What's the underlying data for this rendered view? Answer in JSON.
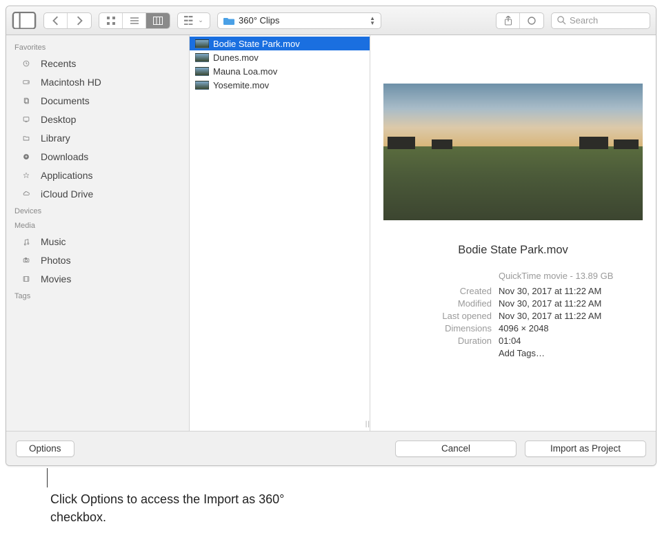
{
  "toolbar": {
    "path_label": "360° Clips",
    "search_placeholder": "Search"
  },
  "sidebar": {
    "favorites_heading": "Favorites",
    "favorites": [
      "Recents",
      "Macintosh HD",
      "Documents",
      "Desktop",
      "Library",
      "Downloads",
      "Applications",
      "iCloud Drive"
    ],
    "devices_heading": "Devices",
    "media_heading": "Media",
    "media": [
      "Music",
      "Photos",
      "Movies"
    ],
    "tags_heading": "Tags"
  },
  "files": [
    {
      "name": "Bodie State Park.mov",
      "selected": true
    },
    {
      "name": "Dunes.mov",
      "selected": false
    },
    {
      "name": "Mauna Loa.mov",
      "selected": false
    },
    {
      "name": "Yosemite.mov",
      "selected": false
    }
  ],
  "preview": {
    "title": "Bodie State Park.mov",
    "kind_size": "QuickTime movie - 13.89 GB",
    "created_label": "Created",
    "created": "Nov 30, 2017 at 11:22 AM",
    "modified_label": "Modified",
    "modified": "Nov 30, 2017 at 11:22 AM",
    "last_opened_label": "Last opened",
    "last_opened": "Nov 30, 2017 at 11:22 AM",
    "dimensions_label": "Dimensions",
    "dimensions": "4096 × 2048",
    "duration_label": "Duration",
    "duration": "01:04",
    "add_tags": "Add Tags…"
  },
  "footer": {
    "options": "Options",
    "cancel": "Cancel",
    "import": "Import as Project"
  },
  "callout": "Click Options to access the Import as 360° checkbox."
}
